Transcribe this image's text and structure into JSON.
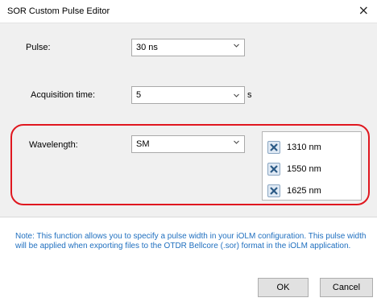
{
  "window": {
    "title": "SOR Custom Pulse Editor",
    "close_symbol": "×"
  },
  "form": {
    "pulse_label": "Pulse:",
    "pulse_value": "30 ns",
    "acquisition_label": "Acquisition time:",
    "acquisition_value": "5",
    "acquisition_unit": "s",
    "wavelength_label": "Wavelength:",
    "wavelength_value": "SM"
  },
  "wavelengths": [
    {
      "label": "1310 nm",
      "checked": true
    },
    {
      "label": "1550 nm",
      "checked": true
    },
    {
      "label": "1625 nm",
      "checked": true
    }
  ],
  "note": "Note: This function allows you to specify a pulse width in your iOLM configuration. This pulse width will be applied when exporting files to the OTDR Bellcore (.sor) format in the iOLM application.",
  "buttons": {
    "ok": "OK",
    "cancel": "Cancel"
  },
  "colors": {
    "highlight": "#e0171f",
    "note_text": "#1f6fbf"
  },
  "icons": {
    "close": "close-icon",
    "dropdown": "chevron-down-icon",
    "checkbox": "x-mark-icon"
  }
}
